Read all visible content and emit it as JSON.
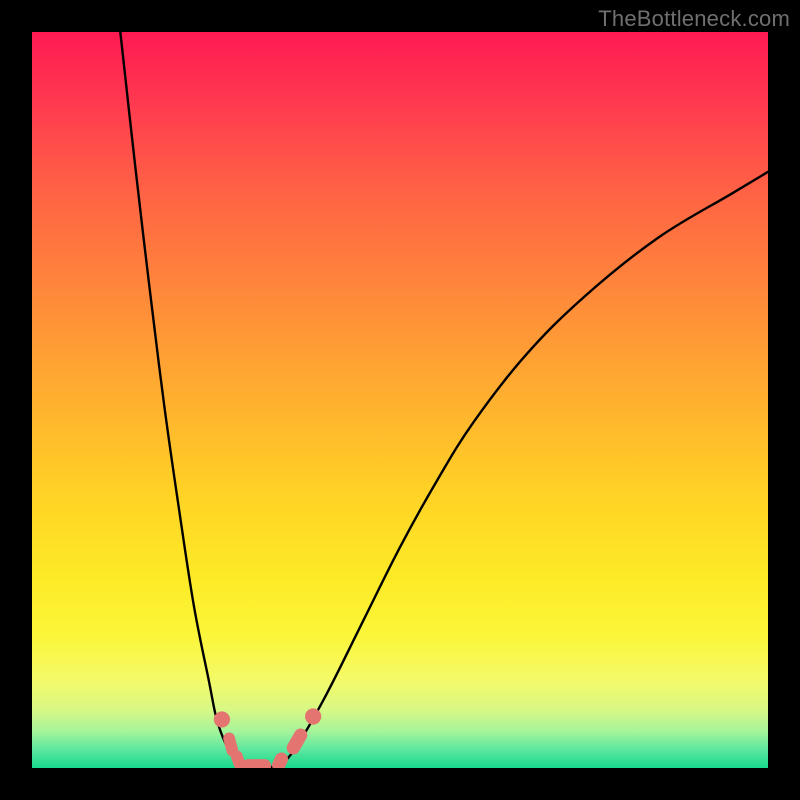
{
  "watermark": "TheBottleneck.com",
  "colors": {
    "frame": "#000000",
    "curve": "#000000",
    "marker": "#e4746f"
  },
  "chart_data": {
    "type": "line",
    "title": "",
    "xlabel": "",
    "ylabel": "",
    "xlim": [
      0,
      100
    ],
    "ylim": [
      0,
      100
    ],
    "grid": false,
    "legend": false,
    "curves": [
      {
        "name": "left-branch",
        "x": [
          12,
          14,
          16,
          18,
          20,
          22,
          24,
          25,
          26,
          27,
          28
        ],
        "y": [
          100,
          82,
          65,
          49,
          35,
          22,
          12,
          7,
          4,
          2,
          0.5
        ]
      },
      {
        "name": "valley",
        "x": [
          28,
          29,
          30,
          31,
          32,
          33,
          34
        ],
        "y": [
          0.5,
          0.2,
          0.1,
          0.1,
          0.1,
          0.2,
          0.5
        ]
      },
      {
        "name": "right-branch",
        "x": [
          34,
          36,
          40,
          45,
          50,
          55,
          60,
          67,
          75,
          85,
          95,
          100
        ],
        "y": [
          0.5,
          3,
          10,
          20,
          30,
          39,
          47,
          56,
          64,
          72,
          78,
          81
        ]
      }
    ],
    "markers": [
      {
        "shape": "circle",
        "cx": 25.8,
        "cy": 6.6,
        "r": 1.1
      },
      {
        "shape": "capsule",
        "cx": 27.0,
        "cy": 3.2,
        "w": 1.6,
        "h": 3.3,
        "angle": -15
      },
      {
        "shape": "capsule",
        "cx": 28.0,
        "cy": 1.1,
        "w": 1.6,
        "h": 2.7,
        "angle": -20
      },
      {
        "shape": "capsule",
        "cx": 30.5,
        "cy": 0.3,
        "w": 4.0,
        "h": 1.8,
        "angle": 0
      },
      {
        "shape": "capsule",
        "cx": 33.7,
        "cy": 0.8,
        "w": 1.8,
        "h": 2.7,
        "angle": 25
      },
      {
        "shape": "capsule",
        "cx": 36.0,
        "cy": 3.6,
        "w": 1.8,
        "h": 3.8,
        "angle": 30
      },
      {
        "shape": "circle",
        "cx": 38.2,
        "cy": 7.0,
        "r": 1.1
      }
    ]
  }
}
